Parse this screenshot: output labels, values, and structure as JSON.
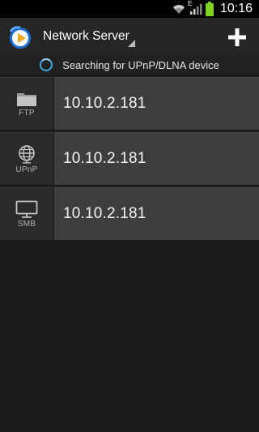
{
  "status_bar": {
    "time": "10:16",
    "network_type": "E",
    "icons": [
      "wifi-icon",
      "signal-icon",
      "battery-icon"
    ]
  },
  "action_bar": {
    "title": "Network Server",
    "logo_icon": "app-logo-icon",
    "add_icon": "plus-icon"
  },
  "search": {
    "text": "Searching for UPnP/DLNA device",
    "spinner_color": "#3fa6e0"
  },
  "servers": [
    {
      "type": "FTP",
      "address": "10.10.2.181",
      "icon": "folder-icon"
    },
    {
      "type": "UPnP",
      "address": "10.10.2.181",
      "icon": "globe-icon"
    },
    {
      "type": "SMB",
      "address": "10.10.2.181",
      "icon": "monitor-icon"
    }
  ],
  "colors": {
    "background": "#1b1b1b",
    "row_address_bg": "#3e3e3e",
    "row_icon_bg": "#2a2a2a",
    "battery": "#7ed321"
  }
}
